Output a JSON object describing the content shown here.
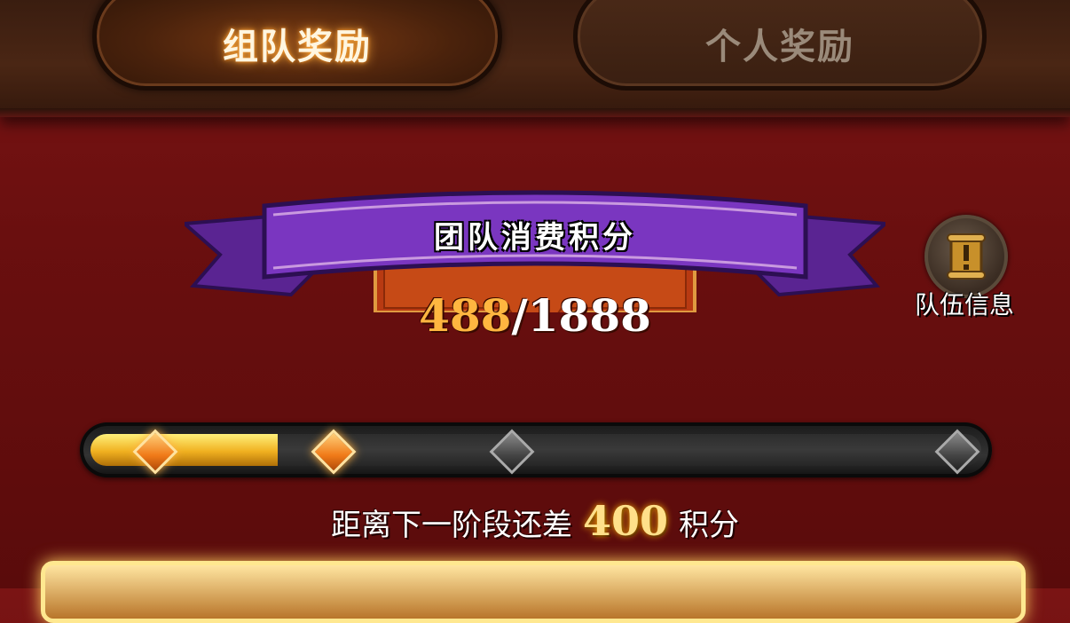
{
  "tabs": {
    "team_label": "组队奖励",
    "personal_label": "个人奖励"
  },
  "score_panel": {
    "title": "团队消费积分",
    "current": "488",
    "separator": "/",
    "total": "1888"
  },
  "team_info": {
    "label": "队伍信息",
    "icon": "scroll-exclamation-icon"
  },
  "progress": {
    "current_points": 488,
    "max_points": 1888,
    "fill_fraction": 0.21,
    "milestones": [
      {
        "state": "reached",
        "position": 0.07
      },
      {
        "state": "next",
        "position": 0.27
      },
      {
        "state": "locked",
        "position": 0.47
      },
      {
        "state": "locked",
        "position": 0.97
      }
    ]
  },
  "remaining": {
    "prefix": "距离下一阶段还差",
    "value": "400",
    "suffix": "积分"
  },
  "colors": {
    "background": "#6a0f0f",
    "ribbon": "#6a2fa8",
    "gold": "#ffb640",
    "bar_fill": "#f0b020"
  }
}
